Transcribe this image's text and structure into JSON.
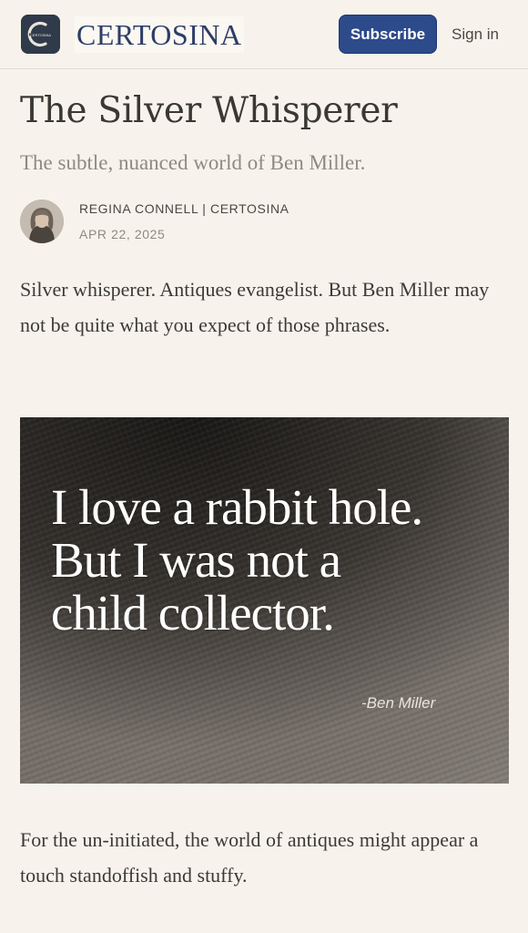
{
  "header": {
    "brand_name": "CERTOSINA",
    "logo_icon": "certosina-monogram-icon",
    "subscribe_label": "Subscribe",
    "signin_label": "Sign in",
    "colors": {
      "brand": "#2e3d69",
      "subscribe_bg": "#2d4a8a",
      "background": "#f7f3ec"
    }
  },
  "article": {
    "title": "The Silver Whisperer",
    "subtitle": "The subtle, nuanced world of Ben Miller.",
    "author": {
      "byline": "REGINA CONNELL | CERTOSINA",
      "avatar": "author-avatar-photo"
    },
    "date": "APR 22, 2025",
    "lede": "Silver whisperer. Antiques evangelist. But Ben Miller may not be quite what you expect of those phrases.",
    "quote_image": {
      "lines": [
        "I love a rabbit hole.",
        "But I was not a",
        "child collector."
      ],
      "attribution": "-Ben Miller"
    },
    "body_paragraph": "For the un-initiated, the world of antiques might appear a touch standoffish and stuffy."
  }
}
